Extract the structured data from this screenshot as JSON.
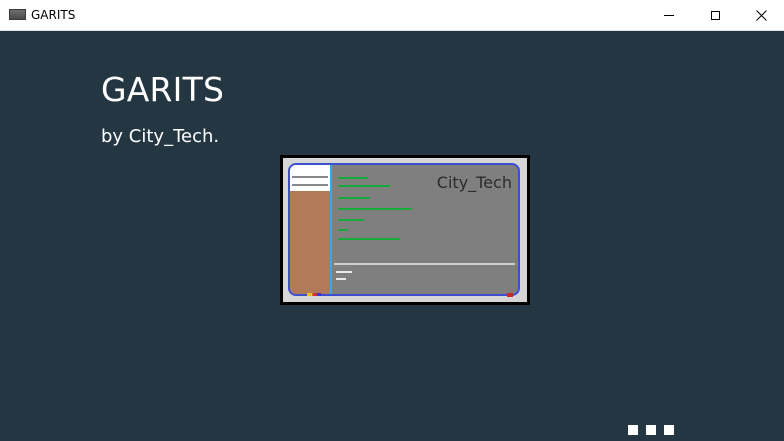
{
  "window": {
    "title": "GARITS",
    "icon": "app-window-icon",
    "controls": [
      "minimize-icon",
      "maximize-icon",
      "close-icon"
    ]
  },
  "splash": {
    "heading": "GARITS",
    "subheading": "by City_Tech.",
    "illustration": {
      "brand_text": "City_Tech"
    },
    "loading_indicator_count": 3
  },
  "colors": {
    "background": "#233642",
    "text": "#ffffff",
    "illustration_frame": "#3d4fd0",
    "illustration_sidebar": "#b37a5a",
    "illustration_lines": "#19a83a"
  }
}
